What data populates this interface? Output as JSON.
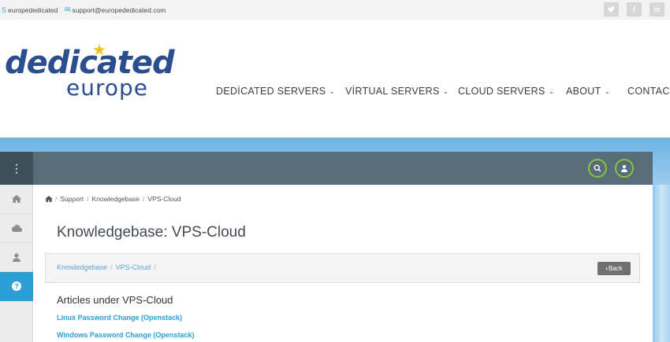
{
  "topbar": {
    "skype": {
      "icon": "skype-icon",
      "text": "europededicated"
    },
    "email": {
      "icon": "mail-icon",
      "text": "support@europededicated.com"
    },
    "social": [
      {
        "icon": "twitter-icon",
        "glyph": "✓"
      },
      {
        "icon": "facebook-icon",
        "glyph": "f"
      },
      {
        "icon": "linkedin-icon",
        "glyph": "in"
      }
    ]
  },
  "logo": {
    "line1": "dedicated",
    "line2": "europe"
  },
  "nav": [
    {
      "label": "DEDİCATED SERVERS"
    },
    {
      "label": "VİRTUAL SERVERS"
    },
    {
      "label": "CLOUD SERVERS"
    },
    {
      "label": "ABOUT"
    },
    {
      "label": "CONTACT"
    }
  ],
  "app": {
    "breadcrumb": [
      "Support",
      "Knowledgebase",
      "VPS-Cloud"
    ],
    "title": "Knowledgebase: VPS-Cloud",
    "kb_crumb": [
      "Knowledgebase",
      "VPS-Cloud"
    ],
    "back_label": "Back",
    "articles_heading": "Articles under VPS-Cloud",
    "articles": [
      "Linux Password Change (Openstack)",
      "Windows Password Change (Openstack)"
    ],
    "sidebar": [
      "home-icon",
      "cloud-icon",
      "user-icon",
      "help-icon"
    ]
  },
  "colors": {
    "accent": "#2a9fd6",
    "appbar": "#576d7a",
    "ring": "#8ac43f",
    "logo": "#2b4f8e"
  }
}
